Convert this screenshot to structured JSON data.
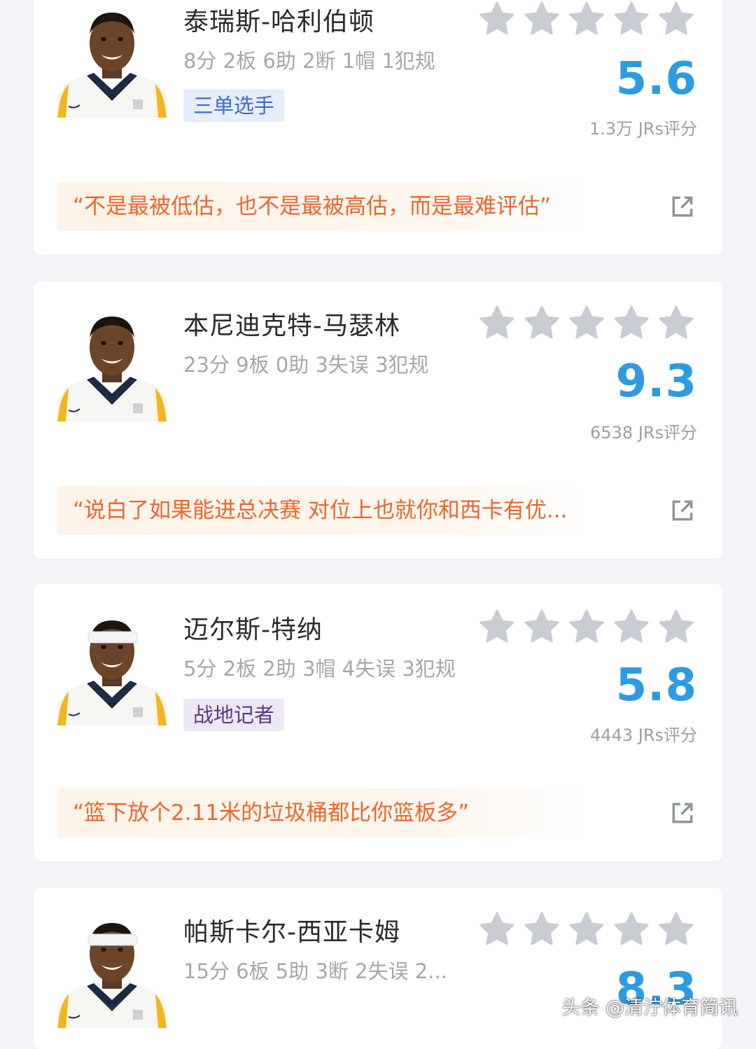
{
  "players": [
    {
      "name": "泰瑞斯-哈利伯顿",
      "stats": "8分 2板 6助 2断 1帽 1犯规",
      "badge": "三单选手",
      "score": "5.6",
      "rating_count": "1.3万 JRs评分",
      "quote": "“不是最被低估，也不是最被高估，而是最难评估”",
      "headwear": "none"
    },
    {
      "name": "本尼迪克特-马瑟林",
      "stats": "23分 9板 0助 3失误 3犯规",
      "badge": "",
      "score": "9.3",
      "rating_count": "6538 JRs评分",
      "quote": "“说白了如果能进总决赛 对位上也就你和西卡有优...",
      "headwear": "none"
    },
    {
      "name": "迈尔斯-特纳",
      "stats": "5分 2板 2助 3帽 4失误 3犯规",
      "badge": "战地记者",
      "score": "5.8",
      "rating_count": "4443 JRs评分",
      "quote": "“篮下放个2.11米的垃圾桶都比你篮板多”",
      "headwear": "headband"
    },
    {
      "name": "帕斯卡尔-西亚卡姆",
      "stats": "15分 6板 5助 3断 2失误 2...",
      "badge": "",
      "score": "8.3",
      "rating_count": "",
      "quote": "",
      "headwear": "headband"
    }
  ],
  "watermark": "头条 @清泞体育简讯",
  "colors": {
    "score": "#2d9be1",
    "quote_text": "#e8672d",
    "star": "#c9ccd3",
    "badge_blue": "#3d6cc6",
    "badge_purple": "#5b3a86"
  },
  "icons": {
    "star": "star-icon",
    "share": "share-icon",
    "avatar": "player-avatar"
  }
}
